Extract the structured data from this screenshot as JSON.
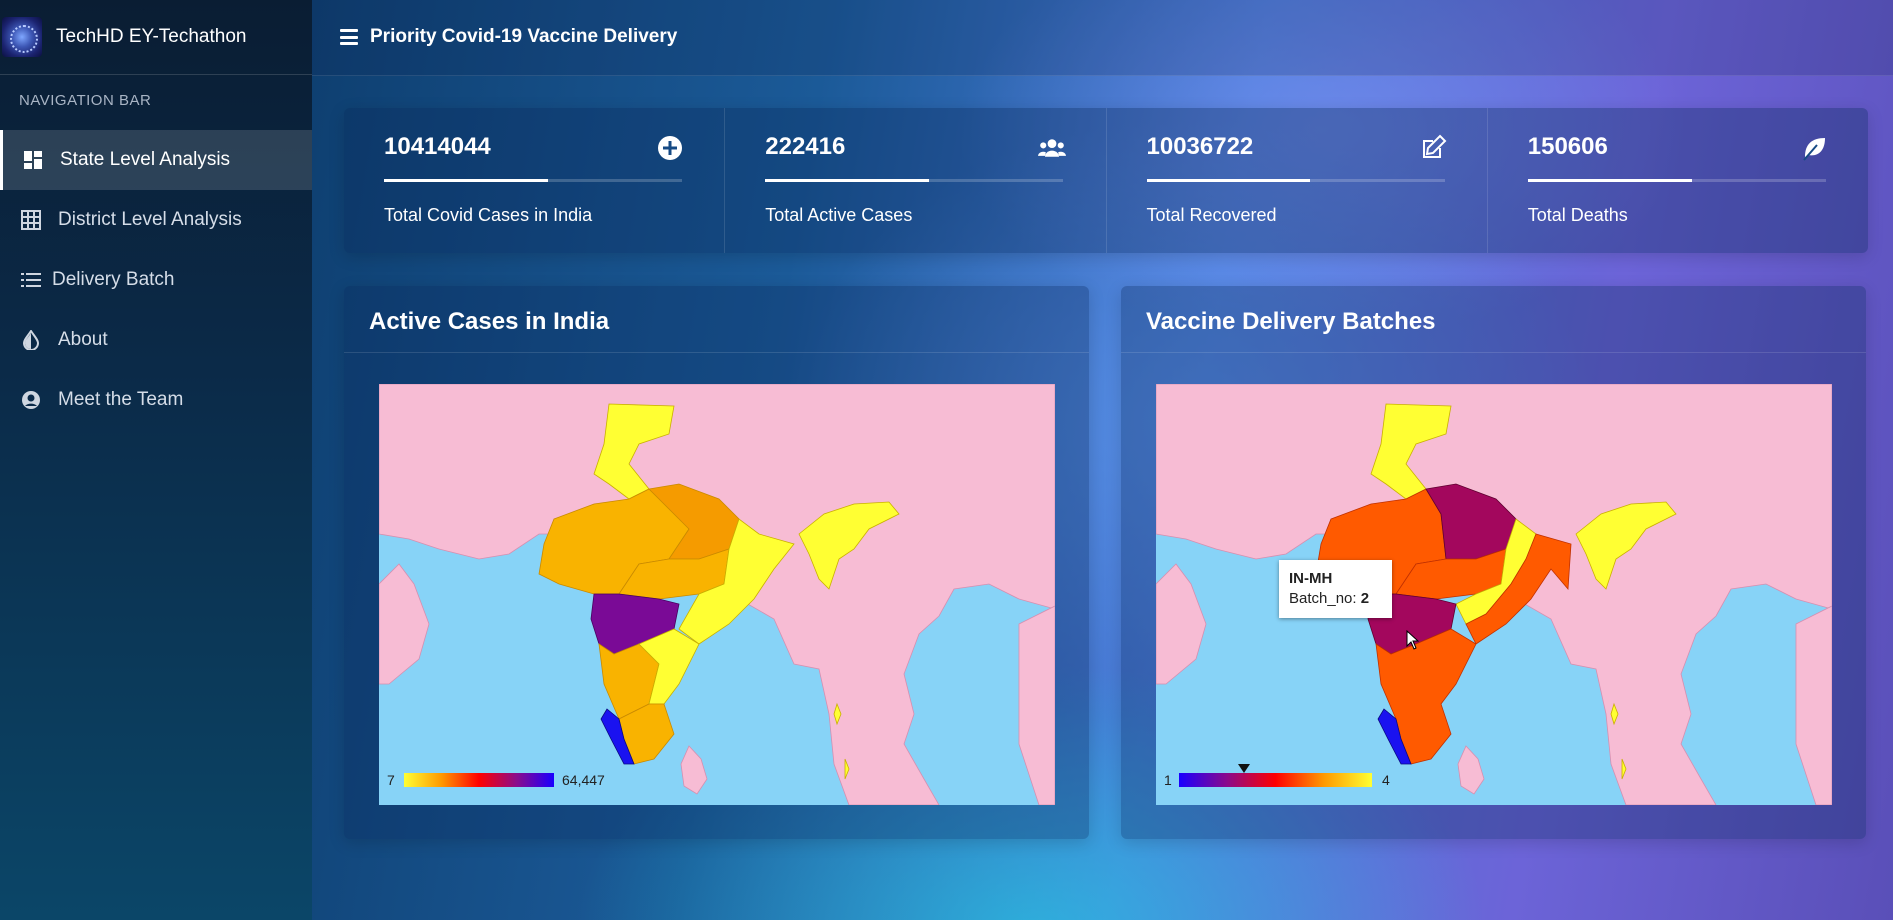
{
  "app": {
    "brand_title": "TechHD EY-Techathon",
    "page_title": "Priority Covid-19 Vaccine Delivery"
  },
  "sidebar": {
    "header": "NAVIGATION BAR",
    "items": [
      {
        "label": "State Level Analysis",
        "icon": "dashboard-icon",
        "active": true
      },
      {
        "label": "District Level Analysis",
        "icon": "grid-icon",
        "active": false
      },
      {
        "label": "Delivery Batch",
        "icon": "list-icon",
        "active": false
      },
      {
        "label": "About",
        "icon": "drop-icon",
        "active": false
      },
      {
        "label": "Meet the Team",
        "icon": "user-circle-icon",
        "active": false
      }
    ]
  },
  "stats": [
    {
      "value": "10414044",
      "label": "Total Covid Cases in India",
      "icon": "plus-circle-icon",
      "progress": 0.55
    },
    {
      "value": "222416",
      "label": "Total Active Cases",
      "icon": "users-icon",
      "progress": 0.55
    },
    {
      "value": "10036722",
      "label": "Total Recovered",
      "icon": "edit-icon",
      "progress": 0.55
    },
    {
      "value": "150606",
      "label": "Total Deaths",
      "icon": "leaf-icon",
      "progress": 0.55
    }
  ],
  "panels": {
    "active_cases": {
      "title": "Active Cases in India",
      "legend_min": "7",
      "legend_max": "64,447"
    },
    "delivery_batches": {
      "title": "Vaccine Delivery Batches",
      "legend_min": "1",
      "legend_max": "4",
      "tooltip": {
        "state": "IN-MH",
        "key": "Batch_no:",
        "value": "2"
      }
    }
  },
  "colors": {
    "sea": "#87d3f7",
    "land": "#f7bcd4",
    "highlight_purple": "#7a0a96",
    "orange": "#f9b300",
    "yellow": "#ffff33",
    "batch_red": "#ff5a00",
    "batch_crimson": "#a3075d",
    "blue": "#1a12f0"
  }
}
